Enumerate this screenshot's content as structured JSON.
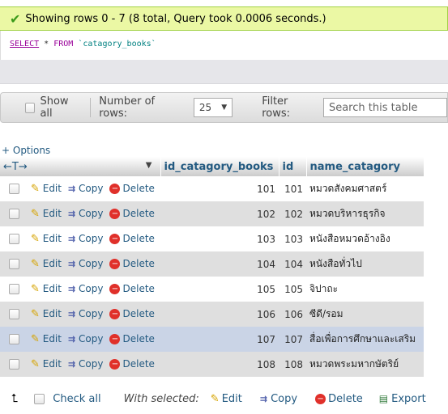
{
  "message": {
    "icon": "check-icon",
    "text": "Showing rows 0 - 7 (8 total, Query took 0.0006 seconds.)"
  },
  "sql": {
    "select_kw": "SELECT",
    "star": "*",
    "from_kw": "FROM",
    "table": "`catagory_books`"
  },
  "nav": {
    "show_all": "Show all",
    "rows_label": "Number of rows:",
    "rows_value": "25",
    "filter_label": "Filter rows:",
    "search_placeholder": "Search this table"
  },
  "options_link": "+ Options",
  "columns": [
    "id_catagory_books",
    "id",
    "name_catagory"
  ],
  "actions": {
    "edit": "Edit",
    "copy": "Copy",
    "delete": "Delete"
  },
  "rows": [
    {
      "id_catagory_books": "101",
      "id": "101",
      "name_catagory": "หมวดสังคมศาสตร์"
    },
    {
      "id_catagory_books": "102",
      "id": "102",
      "name_catagory": "หมวดบริหารธุรกิจ"
    },
    {
      "id_catagory_books": "103",
      "id": "103",
      "name_catagory": "หนังสือหมวดอ้างอิง"
    },
    {
      "id_catagory_books": "104",
      "id": "104",
      "name_catagory": "หนังสือทั่วไป"
    },
    {
      "id_catagory_books": "105",
      "id": "105",
      "name_catagory": "จิปาถะ"
    },
    {
      "id_catagory_books": "106",
      "id": "106",
      "name_catagory": "ซีดี/รอม"
    },
    {
      "id_catagory_books": "107",
      "id": "107",
      "name_catagory": "สื่อเพื่อการศึกษาและเสริม"
    },
    {
      "id_catagory_books": "108",
      "id": "108",
      "name_catagory": "หมวดพระมหากษัตริย์"
    }
  ],
  "bottom": {
    "check_all": "Check all",
    "with_selected": "With selected:",
    "edit": "Edit",
    "copy": "Copy",
    "delete": "Delete",
    "export": "Export"
  }
}
